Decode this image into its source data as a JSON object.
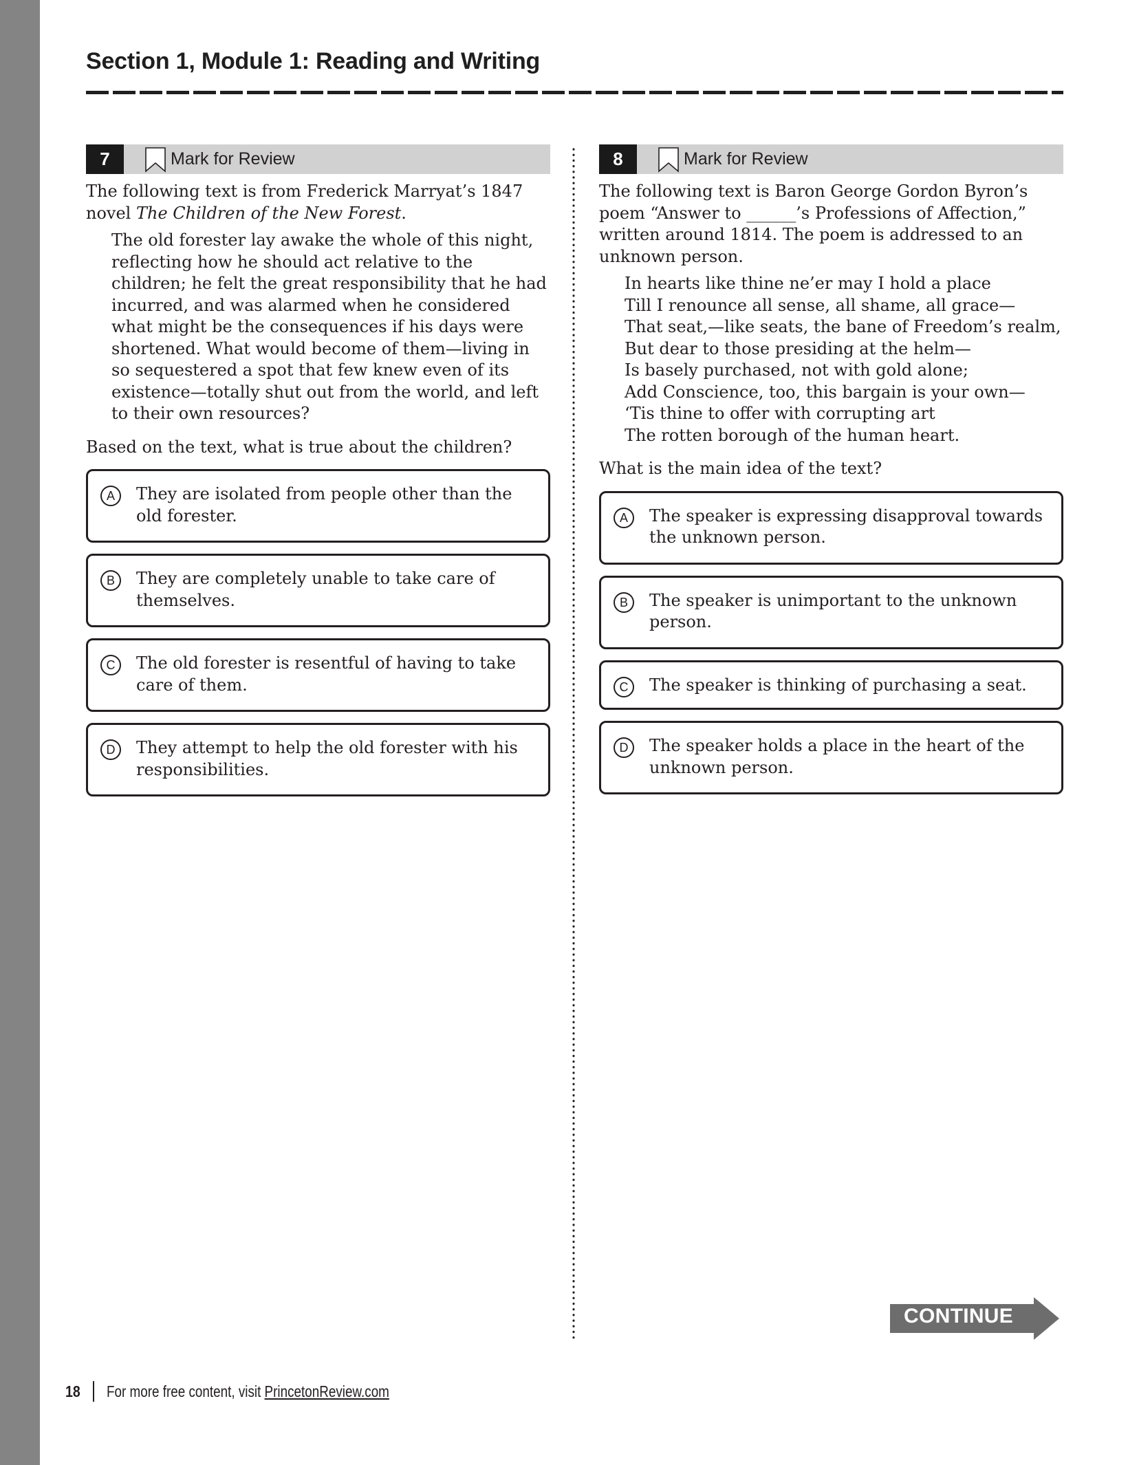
{
  "page": {
    "title": "Section 1, Module 1: Reading and Writing",
    "page_number": "18",
    "footer_text": "For more free content, visit ",
    "footer_link": "PrincetonReview.com",
    "continue_label": "CONTINUE",
    "colors": {
      "side_strip": "#848484",
      "header_bar": "#d1d1d1",
      "question_number_bg": "#1a1a1a",
      "continue_button": "#6d6d6d"
    }
  },
  "questions": [
    {
      "number": "7",
      "mark_label": "Mark for Review",
      "bookmark_icon": "bookmark-icon",
      "intro_before": "The following text is from Frederick Marryat’s 1847 novel ",
      "intro_italic": "The Children of the New Forest",
      "intro_after": ".",
      "passage": "The old forester lay awake the whole of this night, reflecting how he should act relative to the children; he felt the great responsibility that he had incurred, and was alarmed when he considered what might be the consequences if his days were shortened. What would become of them—living in so sequestered a spot that few knew even of its existence—totally shut out from the world, and left to their own resources?",
      "question": "Based on the text, what is true about the children?",
      "options": [
        {
          "letter": "A",
          "text": "They are isolated from people other than the old forester."
        },
        {
          "letter": "B",
          "text": "They are completely unable to take care of themselves."
        },
        {
          "letter": "C",
          "text": "The old forester is resentful of having to take care of them."
        },
        {
          "letter": "D",
          "text": "They attempt to help the old forester with his responsibilities."
        }
      ]
    },
    {
      "number": "8",
      "mark_label": "Mark for Review",
      "bookmark_icon": "bookmark-icon",
      "intro": "The following text is Baron George Gordon Byron’s poem “Answer to ______’s Professions of Affection,” written around 1814. The poem is addressed to an unknown person.",
      "poem_lines": [
        "In hearts like thine ne’er may I hold a place",
        "Till I renounce all sense, all shame, all grace—",
        "That seat,—like seats, the bane of Freedom’s realm,",
        "But dear to those presiding at the helm—",
        "Is basely purchased, not with gold alone;",
        "Add Conscience, too, this bargain is your own—",
        "‘Tis thine to offer with corrupting art",
        "The rotten borough of the human heart."
      ],
      "question": "What is the main idea of the text?",
      "options": [
        {
          "letter": "A",
          "text": "The speaker is expressing disapproval towards the unknown person."
        },
        {
          "letter": "B",
          "text": "The speaker is unimportant to the unknown person."
        },
        {
          "letter": "C",
          "text": "The speaker is thinking of purchasing a seat."
        },
        {
          "letter": "D",
          "text": "The speaker holds a place in the heart of the unknown person."
        }
      ]
    }
  ]
}
